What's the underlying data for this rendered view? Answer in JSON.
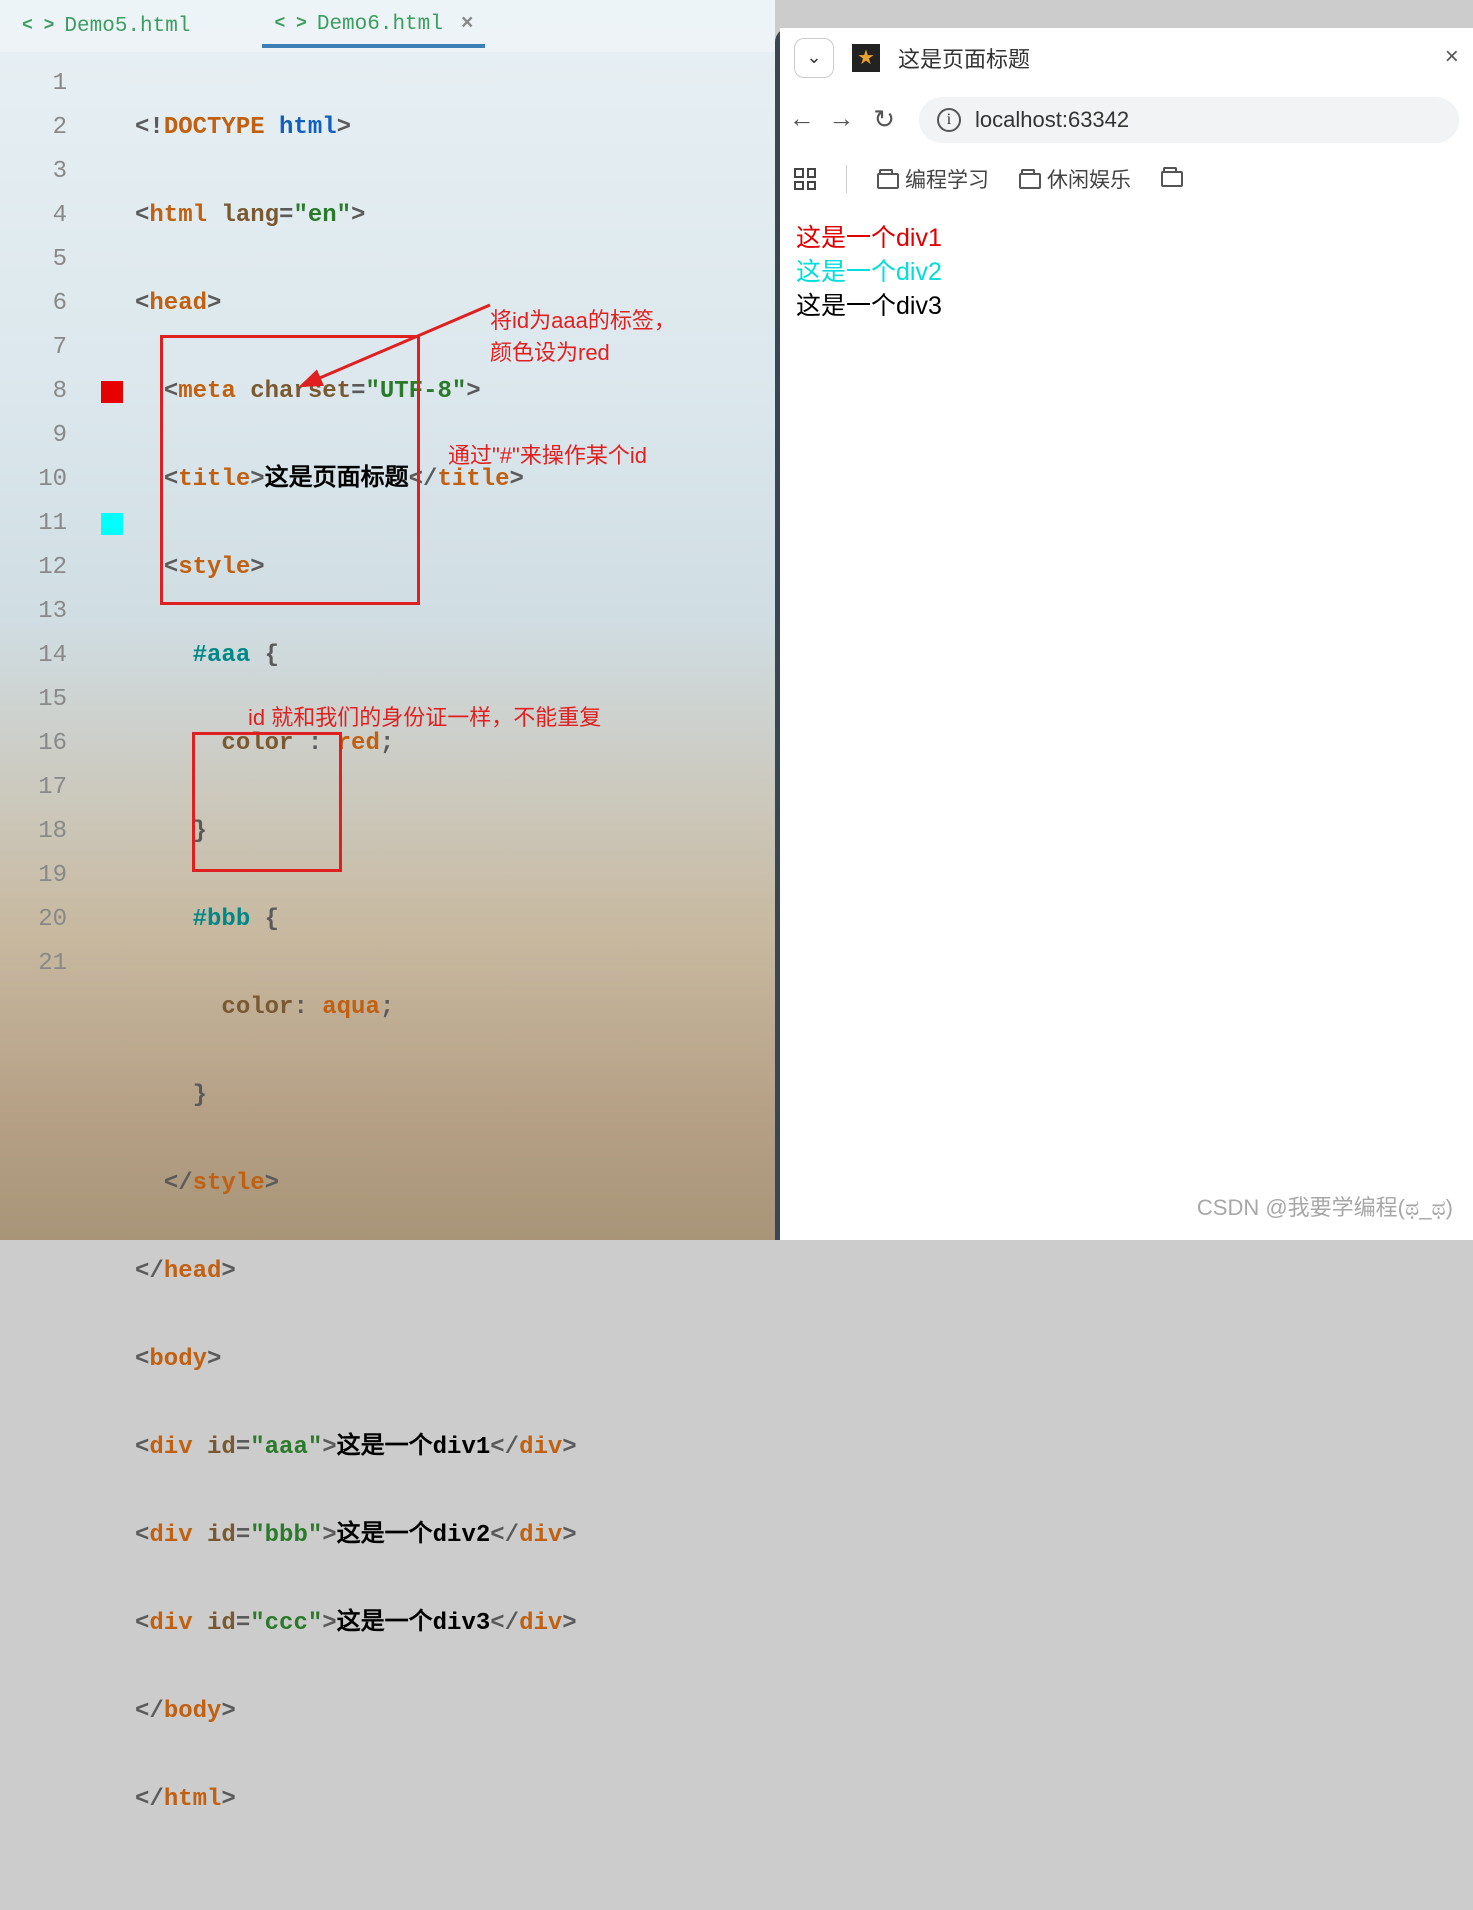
{
  "tabs": {
    "inactive": "Demo5.html",
    "active": "Demo6.html"
  },
  "gutter": [
    "1",
    "2",
    "3",
    "4",
    "5",
    "6",
    "7",
    "8",
    "9",
    "10",
    "11",
    "12",
    "13",
    "14",
    "15",
    "16",
    "17",
    "18",
    "19",
    "20",
    "21"
  ],
  "code": {
    "l1": {
      "a": "<!",
      "b": "DOCTYPE ",
      "c": "html",
      "d": ">"
    },
    "l2": {
      "a": "<",
      "b": "html ",
      "c": "lang",
      "d": "=",
      "e": "\"en\"",
      "f": ">"
    },
    "l3": {
      "a": "<",
      "b": "head",
      "c": ">"
    },
    "l4": {
      "a": "<",
      "b": "meta ",
      "c": "charset",
      "d": "=",
      "e": "\"UTF-8\"",
      "f": ">"
    },
    "l5": {
      "a": "<",
      "b": "title",
      "c": ">",
      "d": "这是页面标题",
      "e": "</",
      "f": "title",
      "g": ">"
    },
    "l6": {
      "a": "<",
      "b": "style",
      "c": ">"
    },
    "l7": {
      "a": "#aaa ",
      "b": "{"
    },
    "l8": {
      "a": "color ",
      "b": ": ",
      "c": "red",
      "d": ";"
    },
    "l9": {
      "a": "}"
    },
    "l10": {
      "a": "#bbb ",
      "b": "{"
    },
    "l11": {
      "a": "color",
      "b": ": ",
      "c": "aqua",
      "d": ";"
    },
    "l12": {
      "a": "}"
    },
    "l13": {
      "a": "</",
      "b": "style",
      "c": ">"
    },
    "l14": {
      "a": "</",
      "b": "head",
      "c": ">"
    },
    "l15": {
      "a": "<",
      "b": "body",
      "c": ">"
    },
    "l16": {
      "a": "<",
      "b": "div ",
      "c": "id",
      "d": "=",
      "e": "\"aaa\"",
      "f": ">",
      "g": "这是一个div1",
      "h": "</",
      "i": "div",
      "j": ">"
    },
    "l17": {
      "a": "<",
      "b": "div ",
      "c": "id",
      "d": "=",
      "e": "\"bbb\"",
      "f": ">",
      "g": "这是一个div2",
      "h": "</",
      "i": "div",
      "j": ">"
    },
    "l18": {
      "a": "<",
      "b": "div ",
      "c": "id",
      "d": "=",
      "e": "\"ccc\"",
      "f": ">",
      "g": "这是一个div3",
      "h": "</",
      "i": "div",
      "j": ">"
    },
    "l19": {
      "a": "</",
      "b": "body",
      "c": ">"
    },
    "l20": {
      "a": "</",
      "b": "html",
      "c": ">"
    }
  },
  "annotations": {
    "a1_line1": "将id为aaa的标签，",
    "a1_line2": "颜色设为red",
    "a2": "通过\"#\"来操作某个id",
    "a3": "id 就和我们的身份证一样，不能重复"
  },
  "browser": {
    "title": "这是页面标题",
    "url": "localhost:63342",
    "bookmarks": {
      "b1": "编程学习",
      "b2": "休闲娱乐"
    },
    "content": {
      "d1": "这是一个div1",
      "d2": "这是一个div2",
      "d3": "这是一个div3"
    }
  },
  "watermark": "CSDN @我要学编程(ಥ_ಥ)"
}
